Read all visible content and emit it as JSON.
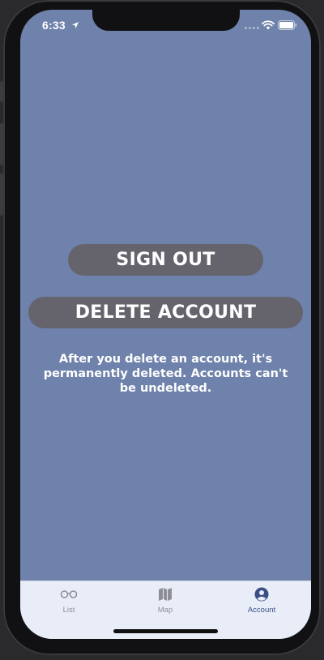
{
  "status_bar": {
    "time": "6:33",
    "location_icon": "location-arrow-icon",
    "wifi_icon": "wifi-icon",
    "battery_icon": "battery-icon"
  },
  "main": {
    "sign_out_label": "SIGN OUT",
    "delete_account_label": "DELETE ACCOUNT",
    "notice_text": "After you delete an account, it's permanently deleted. Accounts can't be undeleted."
  },
  "tabbar": {
    "items": [
      {
        "label": "List",
        "icon": "glasses-icon",
        "active": false
      },
      {
        "label": "Map",
        "icon": "map-icon",
        "active": false
      },
      {
        "label": "Account",
        "icon": "account-icon",
        "active": true
      }
    ]
  },
  "colors": {
    "background": "#6f82ab",
    "button": "#65646d",
    "tabbar": "#e8edf8",
    "active_tab": "#3b4f86",
    "inactive_tab": "#8e8f96"
  }
}
